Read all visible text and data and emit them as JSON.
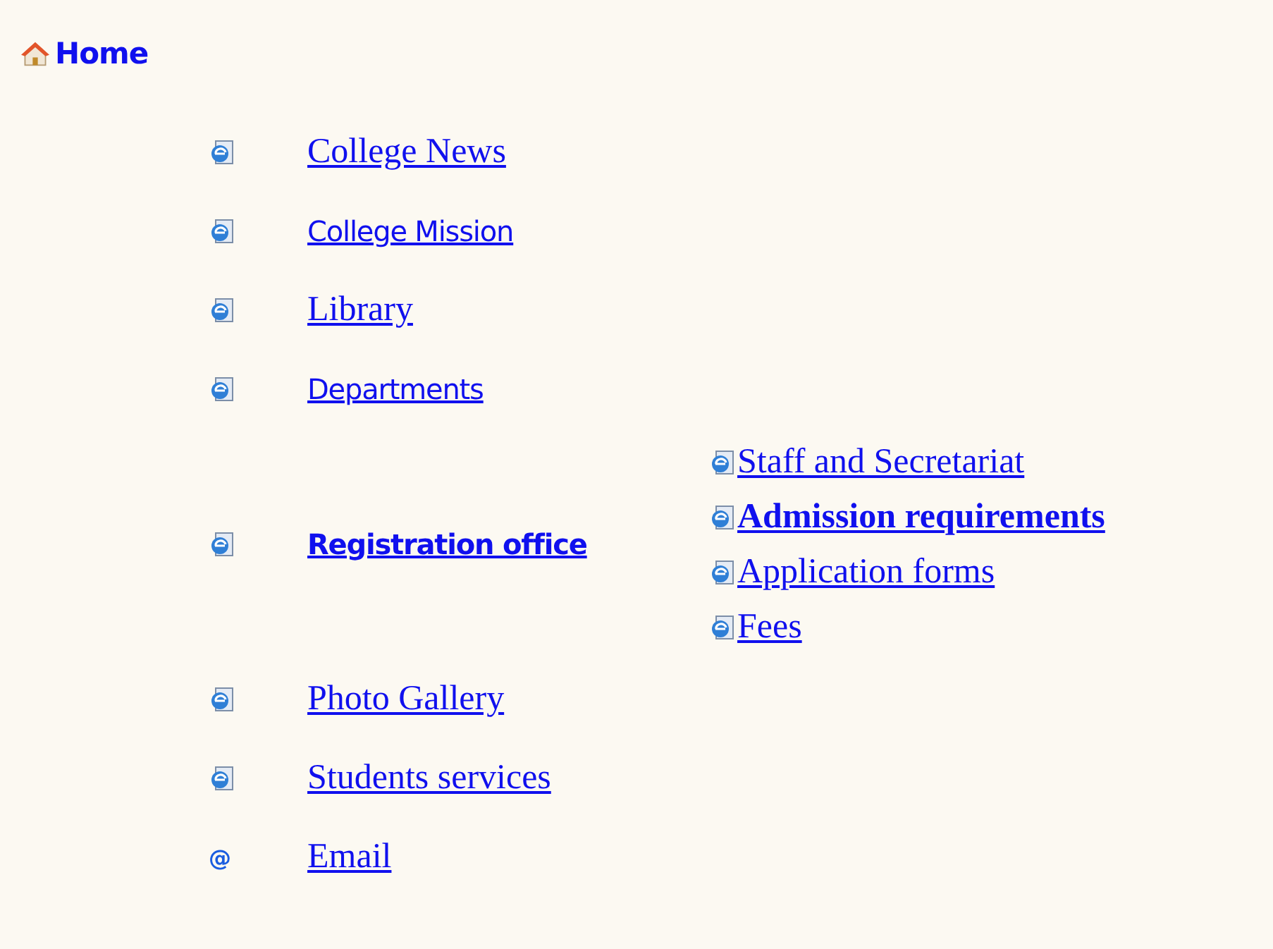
{
  "home": {
    "label": "Home"
  },
  "items": [
    {
      "kind": "page",
      "label": "College News",
      "serif": true,
      "bold": false
    },
    {
      "kind": "page",
      "label": "College Mission ",
      "serif": false,
      "bold": false
    },
    {
      "kind": "page",
      "label": "Library",
      "serif": true,
      "bold": false
    },
    {
      "kind": "page",
      "label": "Departments",
      "serif": false,
      "bold": false
    },
    {
      "kind": "page",
      "label": "Registration office",
      "serif": false,
      "bold": true,
      "children": [
        {
          "label": "Staff and Secretariat",
          "bold": false
        },
        {
          "label": "Admission requirements",
          "bold": true
        },
        {
          "label": "Application forms",
          "bold": false
        },
        {
          "label": "Fees",
          "bold": false
        }
      ]
    },
    {
      "kind": "page",
      "label": "Photo Gallery",
      "serif": true,
      "bold": false
    },
    {
      "kind": "page",
      "label": "Students services",
      "serif": true,
      "bold": false
    },
    {
      "kind": "at",
      "icon_text": "@",
      "label": "Email",
      "serif": true,
      "bold": false
    }
  ]
}
